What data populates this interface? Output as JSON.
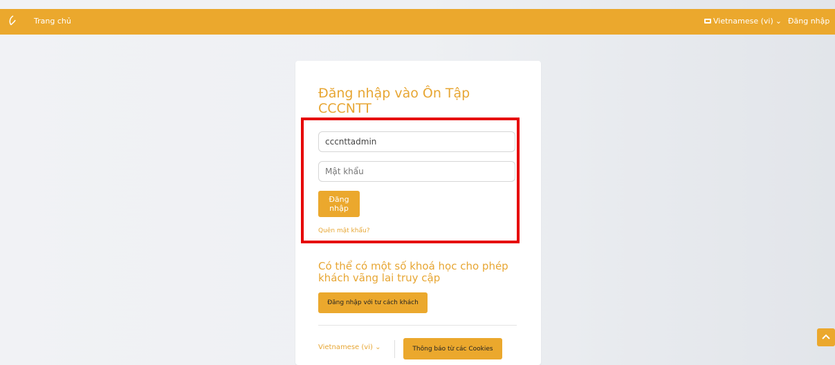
{
  "topbar": {
    "home_label": "Trang chủ",
    "language_label": "Vietnamese (vi)",
    "login_label": "Đăng nhập"
  },
  "login": {
    "title": "Đăng nhập vào Ôn Tập CCCNTT",
    "username_value": "cccnttadmin",
    "password_placeholder": "Mật khẩu",
    "submit_label": "Đăng nhập",
    "forgot_label": "Quên mật khẩu?"
  },
  "guest": {
    "text": "Có thể có một số khoá học cho phép khách vãng lai truy cập",
    "button_label": "Đăng nhập với tư cách khách"
  },
  "footer": {
    "language_label": "Vietnamese (vi)",
    "cookies_label": "Thông báo từ các Cookies"
  },
  "icons": {
    "brand": "brand-logo-icon",
    "language": "language-flag-icon",
    "dropdown": "chevron-down-icon",
    "scroll_top": "chevron-up-icon"
  },
  "colors": {
    "accent": "#eba82d",
    "highlight": "#e60000"
  }
}
